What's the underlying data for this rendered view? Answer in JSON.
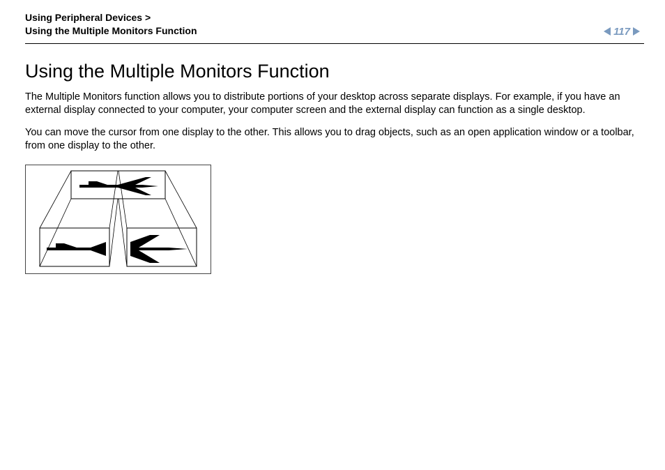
{
  "header": {
    "breadcrumb_parent": "Using Peripheral Devices",
    "breadcrumb_separator": ">",
    "breadcrumb_current": "Using the Multiple Monitors Function",
    "page_number": "117"
  },
  "content": {
    "title": "Using the Multiple Monitors Function",
    "para1": "The Multiple Monitors function allows you to distribute portions of your desktop across separate displays. For example, if you have an external display connected to your computer, your computer screen and the external display can function as a single desktop.",
    "para2": "You can move the cursor from one display to the other. This allows you to drag objects, such as an open application window or a toolbar, from one display to the other."
  },
  "icons": {
    "prev_arrow": "prev-page-icon",
    "next_arrow": "next-page-icon",
    "diagram": "multiple-monitors-diagram"
  }
}
